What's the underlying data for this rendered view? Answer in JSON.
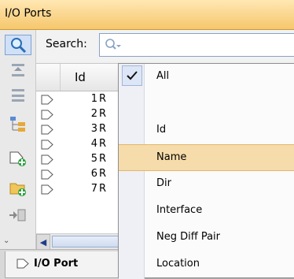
{
  "window": {
    "title": "I/O Ports"
  },
  "search": {
    "label": "Search:",
    "value": ""
  },
  "table": {
    "id_header": "Id",
    "rows": [
      {
        "id": "1",
        "name": "R"
      },
      {
        "id": "2",
        "name": "R"
      },
      {
        "id": "3",
        "name": "R"
      },
      {
        "id": "4",
        "name": "R"
      },
      {
        "id": "5",
        "name": "R"
      },
      {
        "id": "6",
        "name": "R"
      },
      {
        "id": "7",
        "name": "R"
      }
    ]
  },
  "bottom_tabs": [
    {
      "label": "I/O Port"
    }
  ],
  "menu": {
    "items": [
      {
        "label": "All",
        "checked": true
      },
      {
        "label": ""
      },
      {
        "label": "Id"
      },
      {
        "label": "Name",
        "highlighted": true
      },
      {
        "label": "Dir"
      },
      {
        "label": "Interface"
      },
      {
        "label": "Neg Diff Pair"
      },
      {
        "label": "Location"
      }
    ]
  },
  "colors": {
    "title_bar": "#f6c76c",
    "menu_highlight": "#f6dcaa",
    "port_icon_green": "#1a8f2e"
  }
}
